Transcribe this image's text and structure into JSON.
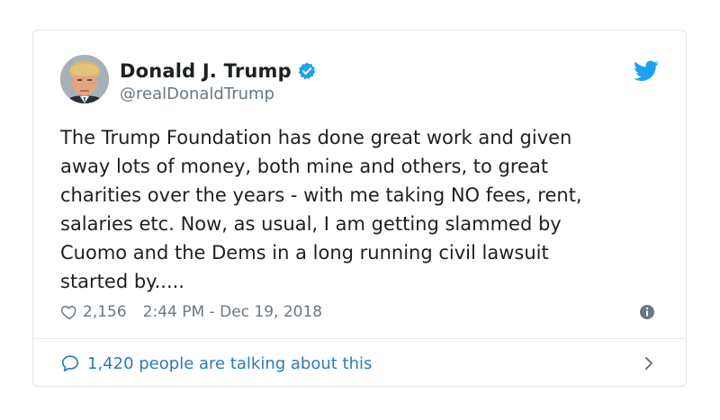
{
  "tweet": {
    "display_name": "Donald J. Trump",
    "handle": "@realDonaldTrump",
    "text": "The Trump Foundation has done great work and given\naway lots of money, both mine and others, to great\ncharities over the years - with me taking NO fees, rent,\nsalaries etc. Now, as usual, I am getting slammed by\nCuomo and the Dems in a long running civil lawsuit\nstarted by.....",
    "likes": "2,156",
    "timestamp": "2:44 PM - Dec 19, 2018"
  },
  "footer": {
    "talking_label": "1,420 people are talking about this"
  },
  "icons": {
    "verified": "verified-badge-icon",
    "brand": "twitter-bird-icon",
    "like": "heart-icon",
    "info": "info-icon",
    "reply": "speech-bubble-icon",
    "chevron": "chevron-right-icon"
  },
  "colors": {
    "twitter_blue": "#1da1f2",
    "link_blue": "#2b7bb9",
    "muted_text": "#697882",
    "border": "#e1e8ed"
  }
}
